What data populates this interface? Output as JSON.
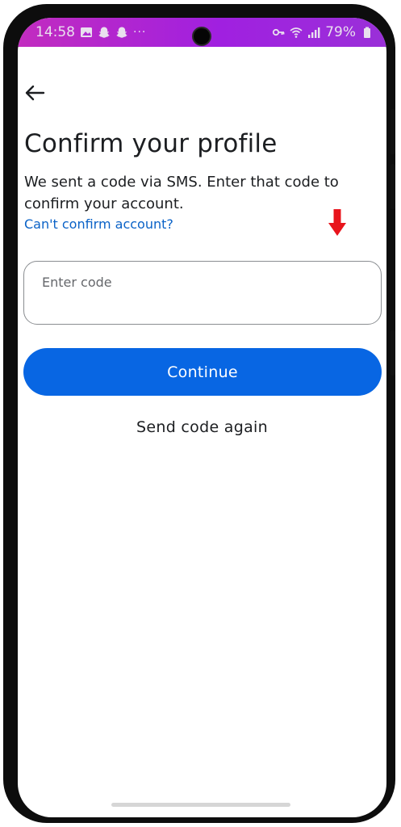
{
  "status_bar": {
    "time": "14:58",
    "battery": "79%",
    "dots": "···",
    "left_icons": [
      "image-icon",
      "snapchat-icon",
      "snapchat-icon"
    ],
    "right_icons": [
      "key-icon",
      "wifi-icon",
      "signal-icon",
      "battery-icon"
    ],
    "gradient_colors": [
      "#c22cbf",
      "#a020e0"
    ]
  },
  "header": {
    "back_icon": "arrow-left-icon",
    "title": "Confirm your profile"
  },
  "main": {
    "description": "We sent a code via SMS. Enter that code to confirm your account.",
    "help_link": "Can't confirm account?",
    "code_field": {
      "placeholder": "Enter code",
      "value": ""
    },
    "continue_label": "Continue",
    "send_again_label": "Send code again",
    "annotation_icon": "red-down-arrow-icon"
  },
  "colors": {
    "primary": "#0866e3",
    "link": "#0a62c7",
    "text": "#1c1e21",
    "annotation": "#e8141c"
  }
}
